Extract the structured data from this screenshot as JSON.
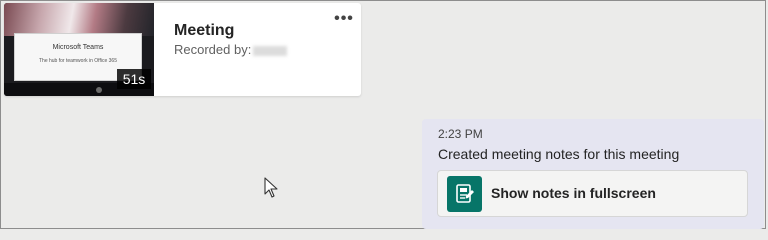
{
  "recording": {
    "title": "Meeting",
    "subtitle": "Recorded by:",
    "duration": "51s",
    "more_label": "•••",
    "slide": {
      "title": "Microsoft Teams",
      "subtitle": "The hub for teamwork in Office 365"
    }
  },
  "message": {
    "time": "2:23 PM",
    "text": "Created meeting notes for this meeting",
    "button_label": "Show notes in fullscreen"
  },
  "colors": {
    "background": "#ebebea",
    "bubble": "#e5e5f1",
    "notes_accent": "#077568"
  },
  "icons": [
    "more-options-icon",
    "notes-icon",
    "mouse-cursor-icon"
  ]
}
